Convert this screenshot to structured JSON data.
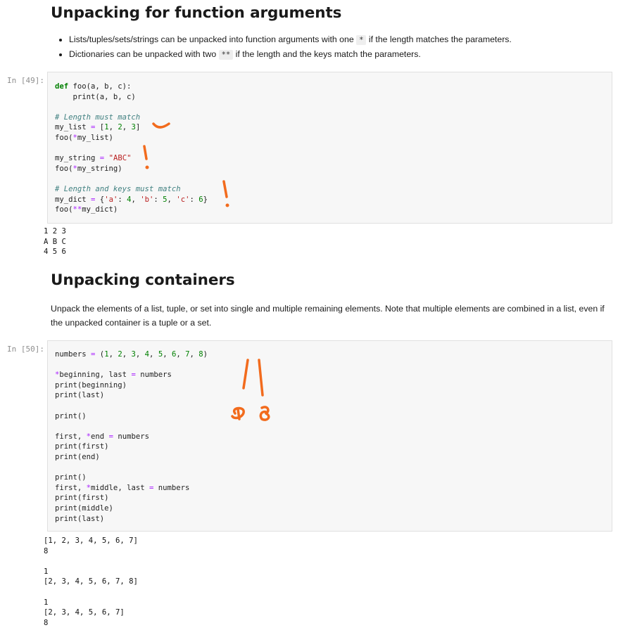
{
  "section1": {
    "heading": "Unpacking for function arguments",
    "bullet1_pre": "Lists/tuples/sets/strings can be unpacked into function arguments with one",
    "bullet1_code": "*",
    "bullet1_post": "if the length matches the parameters.",
    "bullet2_pre": "Dictionaries can be unpacked with two",
    "bullet2_code": "**",
    "bullet2_post": "if the length and the keys match the parameters."
  },
  "cell49": {
    "prompt": "In [49]:",
    "lines": [
      "def foo(a, b, c):",
      "    print(a, b, c)",
      "",
      "# Length must match",
      "my_list = [1, 2, 3]",
      "foo(*my_list)",
      "",
      "my_string = \"ABC\"",
      "foo(*my_string)",
      "",
      "# Length and keys must match",
      "my_dict = {'a': 4, 'b': 5, 'c': 6}",
      "foo(**my_dict)"
    ],
    "output": [
      "1 2 3",
      "A B C",
      "4 5 6"
    ]
  },
  "section2": {
    "heading": "Unpacking containers",
    "paragraph": "Unpack the elements of a list, tuple, or set into single and multiple remaining elements. Note that multiple elements are combined in a list, even if the unpacked container is a tuple or a set."
  },
  "cell50": {
    "prompt": "In [50]:",
    "lines": [
      "numbers = (1, 2, 3, 4, 5, 6, 7, 8)",
      "",
      "*beginning, last = numbers",
      "print(beginning)",
      "print(last)",
      "",
      "print()",
      "",
      "first, *end = numbers",
      "print(first)",
      "print(end)",
      "",
      "print()",
      "first, *middle, last = numbers",
      "print(first)",
      "print(middle)",
      "print(last)"
    ],
    "output": [
      "[1, 2, 3, 4, 5, 6, 7]",
      "8",
      "",
      "1",
      "[2, 3, 4, 5, 6, 7, 8]",
      "",
      "1",
      "[2, 3, 4, 5, 6, 7]",
      "8"
    ]
  },
  "colors": {
    "annotation": "#f26b1d",
    "cell_bg": "#f7f7f7",
    "prompt": "#8f8f8f"
  }
}
